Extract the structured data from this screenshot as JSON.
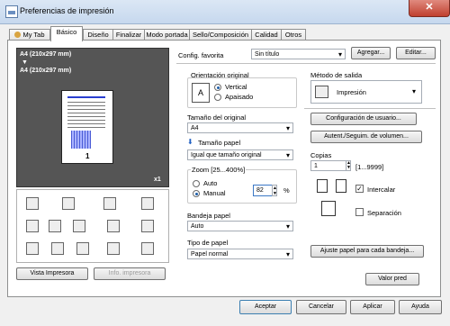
{
  "window": {
    "title": "Preferencias de impresión",
    "close_glyph": "✕"
  },
  "tabs": [
    "My Tab",
    "Básico",
    "Diseño",
    "Finalizar",
    "Modo portada",
    "Sello/Composición",
    "Calidad",
    "Otros"
  ],
  "favorites": {
    "label": "Config. favorita",
    "value": "Sin título",
    "add": "Agregar...",
    "edit": "Editar..."
  },
  "preview": {
    "line1": "A4 (210x297 mm)",
    "arrow": "▼",
    "line2": "A4 (210x297 mm)",
    "page_num": "1",
    "copies_badge": "x1"
  },
  "orientation": {
    "label": "Orientación original",
    "options": [
      "Vertical",
      "Apaisado"
    ],
    "selected": "Vertical"
  },
  "original_size": {
    "label": "Tamaño del original",
    "value": "A4"
  },
  "paper_size": {
    "label": "Tamaño papel",
    "value": "Igual que tamaño original"
  },
  "zoom": {
    "label": "Zoom [25...400%]",
    "options": [
      "Auto",
      "Manual"
    ],
    "selected": "Manual",
    "value": "82",
    "unit": "%"
  },
  "tray": {
    "label": "Bandeja papel",
    "value": "Auto"
  },
  "paper_type": {
    "label": "Tipo de papel",
    "value": "Papel normal"
  },
  "output_method": {
    "label": "Método de salida",
    "value": "Impresión"
  },
  "buttons": {
    "user_config": "Configuración de usuario...",
    "auth": "Autent./Seguim. de volumen...",
    "adjust_paper": "Ajuste papel para cada bandeja...",
    "default_value": "Valor pred",
    "printer_view": "Vista Impresora",
    "printer_info": "Info. impresora",
    "ok": "Aceptar",
    "cancel": "Cancelar",
    "apply": "Aplicar",
    "help": "Ayuda"
  },
  "copies": {
    "label": "Copias",
    "value": "1",
    "range": "[1...9999]"
  },
  "collate": {
    "label": "Intercalar",
    "checked": true
  },
  "separation": {
    "label": "Separación",
    "checked": false
  }
}
